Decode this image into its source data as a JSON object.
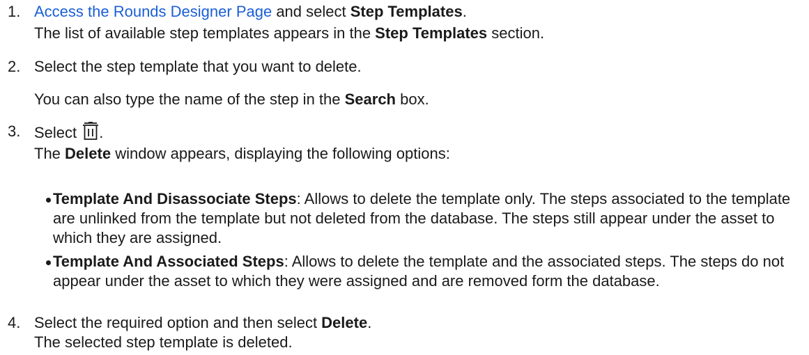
{
  "steps": [
    {
      "number": "1.",
      "link_text": "Access the Rounds Designer Page",
      "text_after_link": " and select ",
      "bold_1": "Step Templates",
      "end_1": ".",
      "line2_pre": "The list of available step templates appears in the ",
      "line2_bold": "Step Templates",
      "line2_post": " section."
    },
    {
      "number": "2.",
      "text": "Select the step template that you want to delete.",
      "note_pre": "You can also type the name of the step in the ",
      "note_bold": "Search",
      "note_post": " box."
    },
    {
      "number": "3.",
      "text_pre": "Select ",
      "icon": "trash-icon",
      "text_post": ".",
      "line2_pre": "The ",
      "line2_bold": "Delete",
      "line2_post": " window appears, displaying the following options:",
      "options": [
        {
          "name": "Template And Disassociate Steps",
          "description": ": Allows to delete the template only. The steps associated to the template are unlinked from the template but not deleted from the database. The steps still appear under the asset to which they are assigned."
        },
        {
          "name": "Template And Associated Steps",
          "description": ": Allows to delete the template and the associated steps. The steps do not appear under the asset to which they were assigned and are removed form the database."
        }
      ]
    },
    {
      "number": "4.",
      "text_pre": "Select the required option and then select ",
      "bold": "Delete",
      "text_post": ".",
      "line2": "The selected step template is deleted."
    }
  ],
  "colors": {
    "link": "#1a5fd6",
    "text": "#1a1a1a"
  }
}
